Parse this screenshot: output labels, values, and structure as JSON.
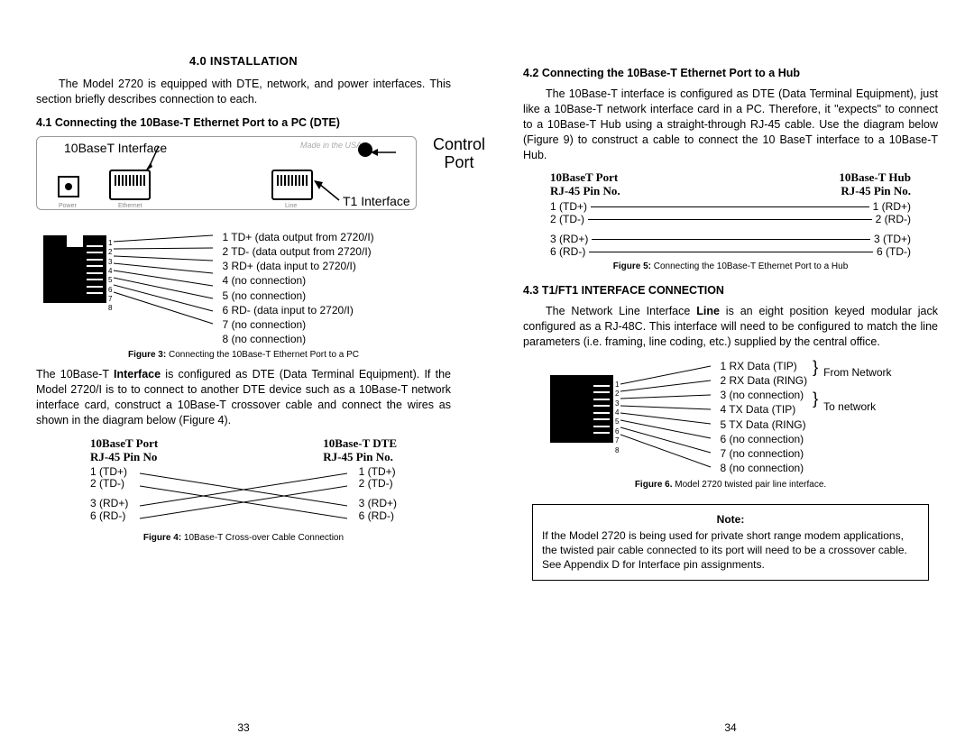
{
  "left": {
    "section_title": "4.0 INSTALLATION",
    "intro": "The Model 2720 is equipped with DTE, network, and power interfaces. This section briefly describes connection to each.",
    "sub41": "4.1 Connecting the 10Base-T Ethernet Port to a PC (DTE)",
    "label_10baset": "10BaseT Interface",
    "made_in_usa": "Made in the USA",
    "control_port1": "Control",
    "control_port2": "Port",
    "t1_interface": "T1 Interface",
    "power_label": "Power",
    "eth_label": "Ethernet",
    "line_label": "Line",
    "pins41": [
      "1 TD+ (data output  from 2720/I)",
      "2 TD- (data output from 2720/I)",
      "3 RD+ (data input to 2720/I)",
      "4 (no connection)",
      "5 (no connection)",
      "6 RD- (data input to 2720/I)",
      "7 (no connection)",
      "8 (no connection)"
    ],
    "fig3_label": "Figure 3:",
    "fig3_text": " Connecting the 10Base-T Ethernet Port to a PC",
    "para41": "The 10Base-T Interface is configured as DTE (Data Terminal Equipment). If the Model 2720/I is to to connect to another DTE device such as a 10Base-T network interface card, construct a 10Base-T crossover cable and connect the wires as shown in the diagram below (Figure 4).",
    "fig4_left_h1": "10BaseT Port",
    "fig4_left_h2": "RJ-45 Pin No",
    "fig4_right_h1": "10Base-T DTE",
    "fig4_right_h2": "RJ-45 Pin No.",
    "fig4_pins_left": [
      "1 (TD+)",
      "2 (TD-)",
      "3 (RD+)",
      "6 (RD-)"
    ],
    "fig4_pins_right": [
      "1 (TD+)",
      "2 (TD-)",
      "3 (RD+)",
      "6 (RD-)"
    ],
    "fig4_label": "Figure 4:",
    "fig4_text": " 10Base-T Cross-over Cable Connection",
    "pagenum": "33"
  },
  "right": {
    "sub42": "4.2 Connecting the 10Base-T Ethernet Port to a Hub",
    "para42": "The 10Base-T interface is configured as DTE (Data Terminal Equipment), just like a 10Base-T network interface card in a PC. Therefore, it \"expects\" to connect to a 10Base-T Hub using a straight-through RJ-45 cable. Use the diagram below (Figure 9) to construct a cable to connect the 10 BaseT interface to a 10Base-T Hub.",
    "fig5_left_h1": "10BaseT Port",
    "fig5_left_h2": "RJ-45 Pin No.",
    "fig5_right_h1": "10Base-T Hub",
    "fig5_right_h2": "RJ-45 Pin No.",
    "fig5_left": [
      "1 (TD+)",
      "2 (TD-)",
      "3 (RD+)",
      "6 (RD-)"
    ],
    "fig5_right": [
      "1 (RD+)",
      "2 (RD-)",
      "3 (TD+)",
      "6 (TD-)"
    ],
    "fig5_label": "Figure 5:",
    "fig5_text": " Connecting the 10Base-T Ethernet Port to a Hub",
    "sub43": "4.3 T1/FT1 INTERFACE CONNECTION",
    "para43": "The Network Line Interface Line is an eight position keyed modular jack configured as a RJ-48C. This interface will need to be configured to match the line parameters (i.e. framing, line coding, etc.) supplied by the central office.",
    "t1_pins": [
      "1 RX Data (TIP)",
      "2 RX Data (RING)",
      "3 (no connection)",
      "4 TX Data (TIP)",
      "5 TX Data (RING)",
      "6 (no connection)",
      "7 (no connection)",
      "8 (no connection)"
    ],
    "brace_from": "From Network",
    "brace_to": "To network",
    "fig6_label": "Figure 6.",
    "fig6_text": "  Model 2720 twisted pair line interface.",
    "note_title": "Note:",
    "note_text": "If the Model 2720 is being used for private short range modem applications, the twisted pair cable connected to its port will need to be a crossover cable. See Appendix D for Interface pin assignments.",
    "pagenum": "34"
  }
}
